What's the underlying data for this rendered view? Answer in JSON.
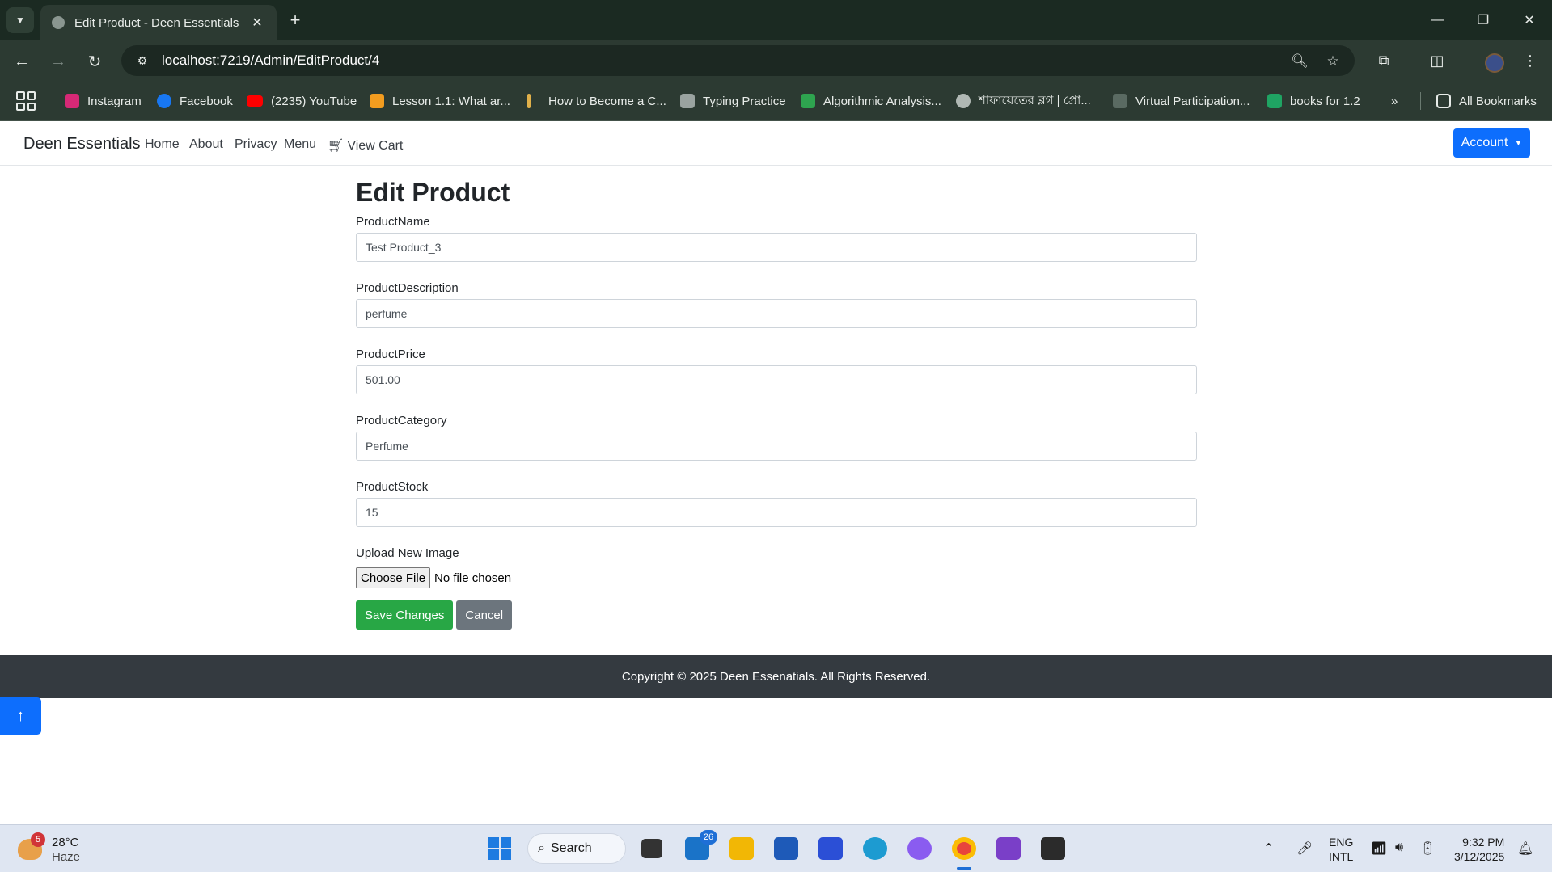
{
  "browser": {
    "tab_title": "Edit Product - Deen Essentials",
    "url": "localhost:7219/Admin/EditProduct/4",
    "bookmarks": [
      {
        "label": "Instagram",
        "color": "#d62976"
      },
      {
        "label": "Facebook",
        "color": "#1877f2"
      },
      {
        "label": "(2235) YouTube",
        "color": "#ff0000"
      },
      {
        "label": "Lesson 1.1: What ar...",
        "color": "#f29c1f"
      },
      {
        "label": "How to Become a C...",
        "color": "#e0b04a"
      },
      {
        "label": "Typing Practice",
        "color": "#9aa3a0"
      },
      {
        "label": "Algorithmic Analysis...",
        "color": "#2ea44f"
      },
      {
        "label": "শাফায়েতের ব্লগ | প্রো...",
        "color": "#b0b8b4"
      },
      {
        "label": "Virtual Participation...",
        "color": "#5a6a62"
      },
      {
        "label": "books for 1.2",
        "color": "#1fa463"
      }
    ],
    "all_bookmarks": "All Bookmarks"
  },
  "site": {
    "brand": "Deen Essentials",
    "nav": [
      "Home",
      "About",
      "Privacy",
      "Menu",
      "View Cart"
    ],
    "account_label": "Account"
  },
  "form": {
    "title": "Edit Product",
    "fields": [
      {
        "label": "ProductName",
        "value": "Test Product_3"
      },
      {
        "label": "ProductDescription",
        "value": "perfume"
      },
      {
        "label": "ProductPrice",
        "value": "501.00"
      },
      {
        "label": "ProductCategory",
        "value": "Perfume"
      },
      {
        "label": "ProductStock",
        "value": "15"
      }
    ],
    "upload_label": "Upload New Image",
    "choose_file": "Choose File",
    "file_status": "No file chosen",
    "save_label": "Save Changes",
    "cancel_label": "Cancel"
  },
  "footer": {
    "text": "Copyright © 2025 Deen Essenatials. All Rights Reserved."
  },
  "taskbar": {
    "weather_badge": "5",
    "temperature": "28°C",
    "condition": "Haze",
    "search_label": "Search",
    "mail_badge": "26",
    "lang_line1": "ENG",
    "lang_line2": "INTL",
    "time": "9:32 PM",
    "date": "3/12/2025"
  },
  "colors": {
    "primary": "#0d6efd",
    "success": "#28a745",
    "secondary": "#6c757d",
    "footer_bg": "#343a40"
  }
}
